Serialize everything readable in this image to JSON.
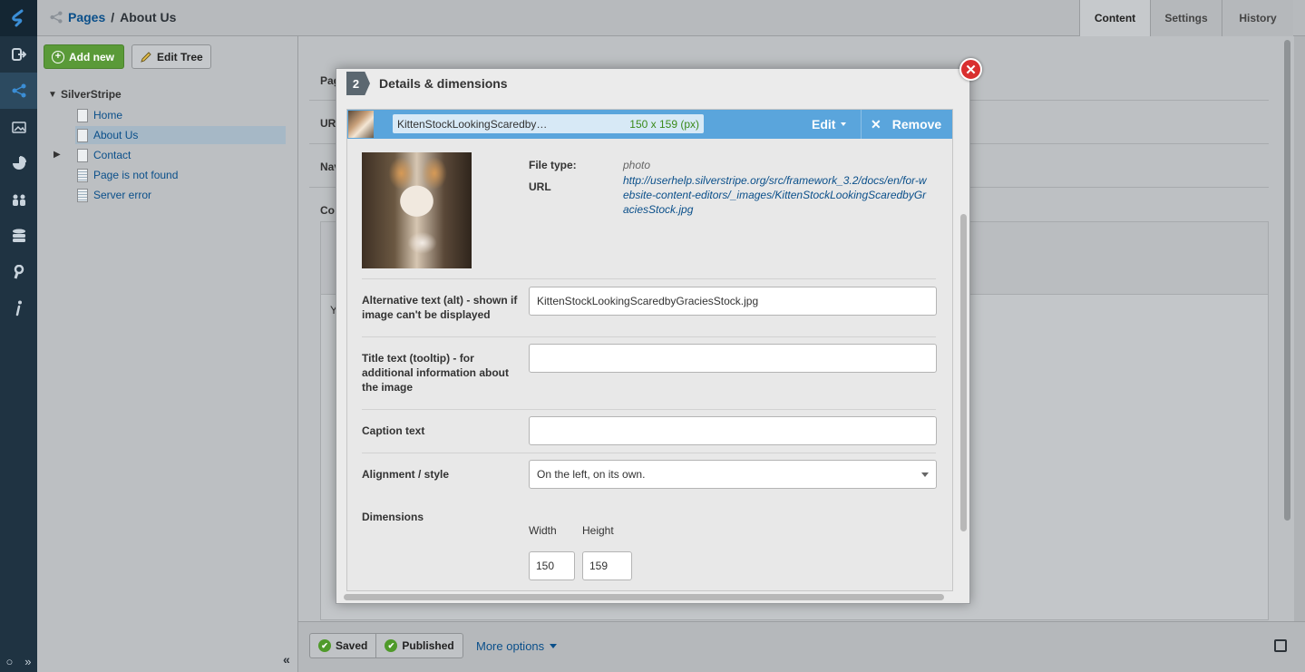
{
  "header": {
    "breadcrumb_parent": "Pages",
    "breadcrumb_separator": "/",
    "breadcrumb_current": "About Us",
    "tabs": [
      {
        "label": "Content",
        "active": true
      },
      {
        "label": "Settings",
        "active": false
      },
      {
        "label": "History",
        "active": false
      }
    ]
  },
  "rail": {
    "icons": [
      "silverstripe-logo-icon",
      "logout-icon",
      "pages-tree-icon",
      "files-icon",
      "reports-icon",
      "security-icon",
      "database-icon",
      "settings-icon",
      "help-icon"
    ],
    "active": "pages-tree-icon"
  },
  "tree_panel": {
    "add_new_label": "Add new",
    "edit_tree_label": "Edit Tree",
    "root_label": "SilverStripe",
    "items": [
      {
        "label": "Home",
        "selected": false,
        "expandable": false,
        "icon": "page-icon"
      },
      {
        "label": "About Us",
        "selected": true,
        "expandable": false,
        "icon": "page-icon"
      },
      {
        "label": "Contact",
        "selected": false,
        "expandable": true,
        "icon": "page-icon"
      },
      {
        "label": "Page is not found",
        "selected": false,
        "expandable": false,
        "icon": "error-page-icon"
      },
      {
        "label": "Server error",
        "selected": false,
        "expandable": false,
        "icon": "error-page-icon"
      }
    ],
    "collapse_symbol": "«"
  },
  "background_form": {
    "labels": [
      "Pag",
      "UR",
      "Nav",
      "Co"
    ],
    "editor_text": "Y"
  },
  "modal": {
    "step_number": "2",
    "title": "Details & dimensions",
    "close_symbol": "✕",
    "file": {
      "name": "KittenStockLookingScaredby…",
      "dimensions": "150 x 159 (px)",
      "edit_label": "Edit",
      "remove_symbol": "✕",
      "remove_label": "Remove"
    },
    "meta": {
      "file_type_label": "File type:",
      "file_type_value": "photo",
      "url_label": "URL",
      "url_value": "http://userhelp.silverstripe.org/src/framework_3.2/docs/en/for-website-content-editors/_images/KittenStockLookingScaredbyGraciesStock.jpg"
    },
    "fields": {
      "alt_label": "Alternative text (alt) - shown if image can't be displayed",
      "alt_value": "KittenStockLookingScaredbyGraciesStock.jpg",
      "title_label": "Title text (tooltip) - for additional information about the image",
      "title_value": "",
      "caption_label": "Caption text",
      "caption_value": "",
      "alignment_label": "Alignment / style",
      "alignment_value": "On the left, on its own.",
      "dimensions_label": "Dimensions",
      "width_label": "Width",
      "height_label": "Height",
      "width_value": "150",
      "height_value": "159"
    }
  },
  "bottom_bar": {
    "saved_label": "Saved",
    "published_label": "Published",
    "more_options_label": "More options"
  }
}
